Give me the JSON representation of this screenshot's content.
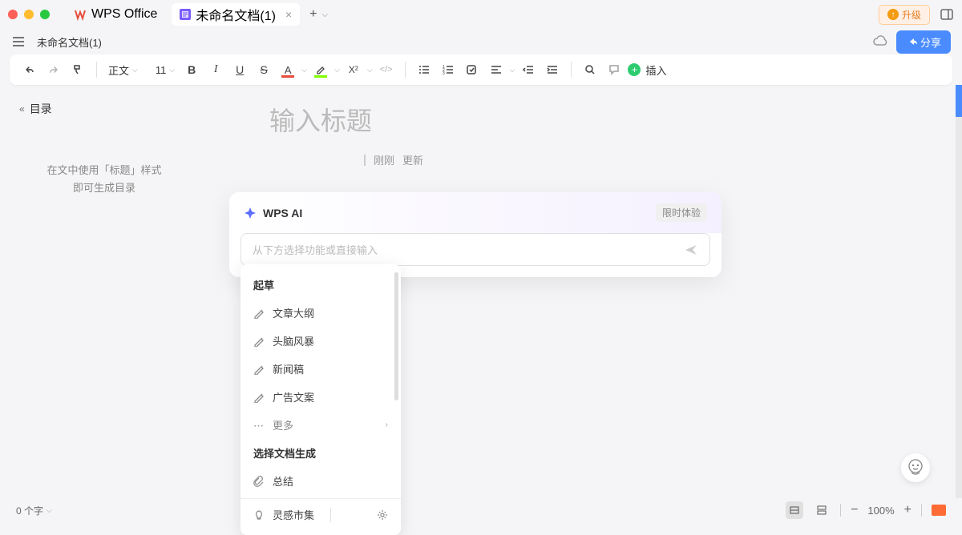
{
  "titlebar": {
    "app_name": "WPS Office",
    "doc_tab_title": "未命名文档(1)",
    "upgrade_label": "升级"
  },
  "secondbar": {
    "doc_name": "未命名文档(1)",
    "share_label": "分享"
  },
  "toolbar": {
    "style_label": "正文",
    "font_size": "11",
    "insert_label": "插入"
  },
  "toc": {
    "header": "目录",
    "hint_line1": "在文中使用「标题」样式",
    "hint_line2": "即可生成目录"
  },
  "content": {
    "title_placeholder": "输入标题",
    "update_recent": "刚刚",
    "update_label": "更新"
  },
  "ai": {
    "title": "WPS AI",
    "badge": "限时体验",
    "input_placeholder": "从下方选择功能或直接输入",
    "section_draft": "起草",
    "items": {
      "outline": "文章大纲",
      "brainstorm": "头脑风暴",
      "news": "新闻稿",
      "ad": "广告文案",
      "more": "更多"
    },
    "section_select": "选择文档生成",
    "summary": "总结",
    "inspiration": "灵感市集"
  },
  "statusbar": {
    "word_count": "0 个字",
    "zoom": "100%"
  }
}
